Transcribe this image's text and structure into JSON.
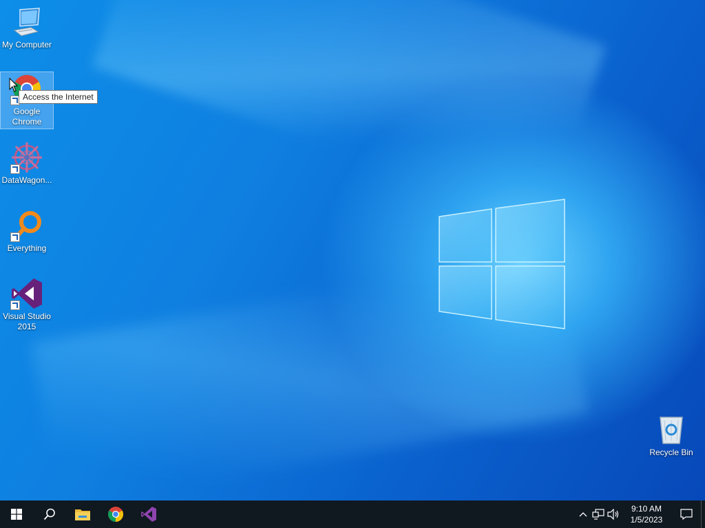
{
  "desktop": {
    "icons": [
      {
        "label": "My Computer",
        "icon": "computer-icon"
      },
      {
        "label": "Google\nChrome",
        "icon": "chrome-icon"
      },
      {
        "label": "DataWagon...",
        "icon": "datawagon-icon"
      },
      {
        "label": "Everything",
        "icon": "everything-search-icon"
      },
      {
        "label": "Visual Studio\n2015",
        "icon": "visual-studio-icon"
      },
      {
        "label": "Recycle Bin",
        "icon": "recycle-bin-icon"
      }
    ],
    "tooltip": "Access the Internet"
  },
  "taskbar": {
    "pinned": [
      "start-icon",
      "search-icon",
      "file-explorer-icon",
      "chrome-icon",
      "visual-studio-icon"
    ],
    "clock": {
      "time": "9:10 AM",
      "date": "1/5/2023"
    }
  },
  "colors": {
    "taskbar": "#101820",
    "accent": "#0a74da"
  }
}
